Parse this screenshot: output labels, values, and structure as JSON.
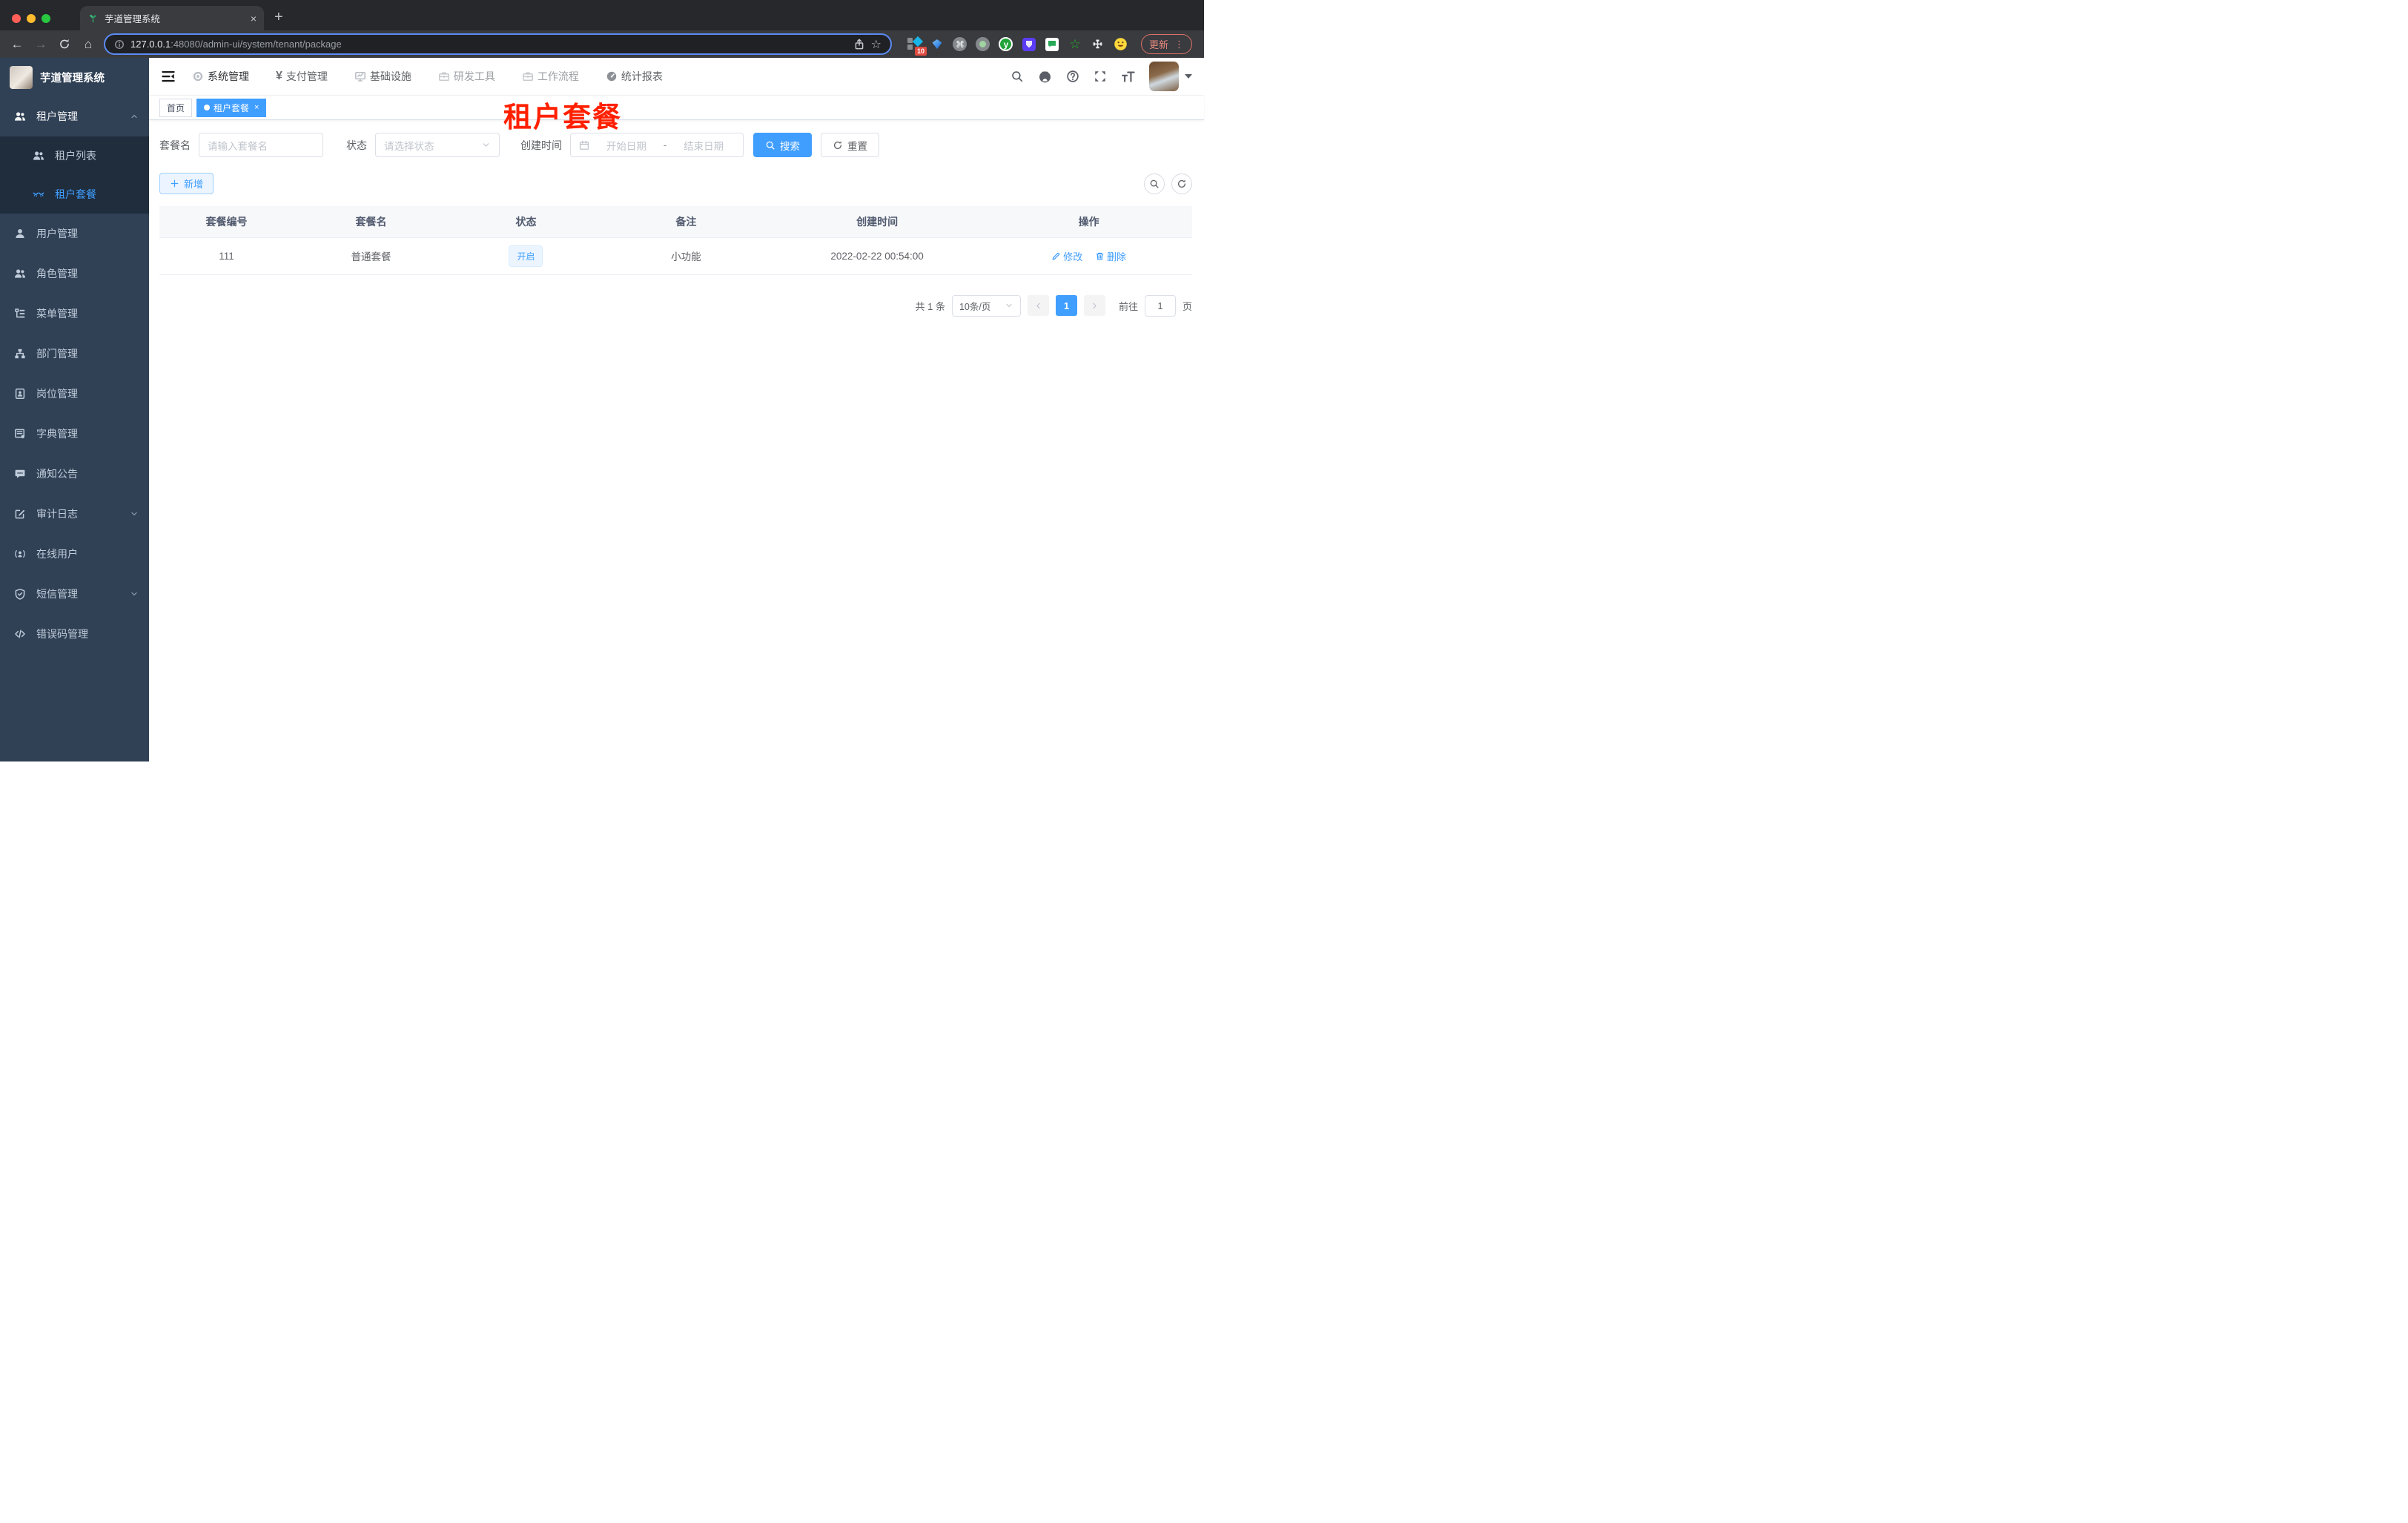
{
  "colors": {
    "accent": "#409eff",
    "page_title_red": "#ff2000",
    "sidebar_bg": "#304156",
    "submenu_bg": "#1f2d3d"
  },
  "browser": {
    "tab_title": "芋道管理系统",
    "new_tab_label": "+",
    "close_tab_label": "×",
    "url_host": "127.0.0.1",
    "url_path": ":48080/admin-ui/system/tenant/package",
    "extension_badge": "10",
    "cmd_glyph": "⌘",
    "ext_y_label": "y",
    "star_glyph": "☆",
    "update_label": "更新",
    "menu_dots": "⋮",
    "back_glyph": "←",
    "forward_glyph": "→",
    "home_glyph": "⌂"
  },
  "sidebar": {
    "logo_title": "芋道管理系统",
    "items": [
      {
        "label": "租户管理"
      },
      {
        "label": "租户列表"
      },
      {
        "label": "租户套餐"
      },
      {
        "label": "用户管理"
      },
      {
        "label": "角色管理"
      },
      {
        "label": "菜单管理"
      },
      {
        "label": "部门管理"
      },
      {
        "label": "岗位管理"
      },
      {
        "label": "字典管理"
      },
      {
        "label": "通知公告"
      },
      {
        "label": "审计日志"
      },
      {
        "label": "在线用户"
      },
      {
        "label": "短信管理"
      },
      {
        "label": "错误码管理"
      }
    ]
  },
  "navbar": {
    "menus": [
      {
        "label": "系统管理"
      },
      {
        "label": "支付管理",
        "glyph": "¥"
      },
      {
        "label": "基础设施"
      },
      {
        "label": "研发工具"
      },
      {
        "label": "工作流程"
      },
      {
        "label": "统计报表"
      }
    ]
  },
  "tags": {
    "home": "首页",
    "current": "租户套餐",
    "close": "×"
  },
  "page_title": "租户套餐",
  "filters": {
    "name_label": "套餐名",
    "name_placeholder": "请输入套餐名",
    "status_label": "状态",
    "status_placeholder": "请选择状态",
    "date_label": "创建时间",
    "date_start_placeholder": "开始日期",
    "date_separator": "-",
    "date_end_placeholder": "结束日期",
    "search_label": "搜索",
    "reset_label": "重置"
  },
  "toolbar": {
    "add_label": "新增"
  },
  "table": {
    "columns": [
      "套餐编号",
      "套餐名",
      "状态",
      "备注",
      "创建时间",
      "操作"
    ],
    "row": {
      "id": "111",
      "name": "普通套餐",
      "status": "开启",
      "remark": "小功能",
      "created_at": "2022-02-22 00:54:00",
      "edit_label": "修改",
      "delete_label": "删除"
    }
  },
  "pagination": {
    "total": "共 1 条",
    "page_size": "10条/页",
    "page": "1",
    "goto_label": "前往",
    "goto_value": "1",
    "unit_label": "页"
  }
}
